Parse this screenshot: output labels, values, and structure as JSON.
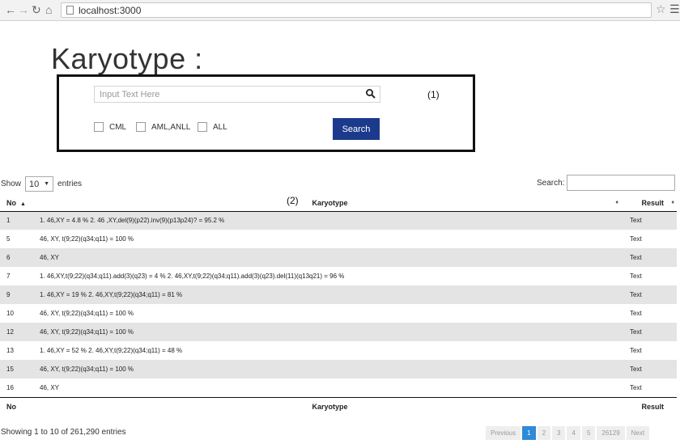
{
  "browser": {
    "url": "localhost:3000"
  },
  "page": {
    "title": "Karyotype :"
  },
  "search_panel": {
    "placeholder": "Input Text Here",
    "annotation": "(1)",
    "checkboxes": [
      {
        "label": "CML",
        "checked": false
      },
      {
        "label": "AML,ANLL",
        "checked": false
      },
      {
        "label": "ALL",
        "checked": false
      }
    ],
    "search_button": "Search"
  },
  "table_controls": {
    "show_label": "Show",
    "page_length": "10",
    "entries_label": "entries",
    "search_label": "Search:"
  },
  "table": {
    "annotation": "(2)",
    "columns": [
      "No",
      "Karyotype",
      "Result"
    ],
    "rows": [
      {
        "no": "1",
        "karyotype": "1. 46,XY = 4.8 % 2. 46 ,XY,del(9)(p22).inv(9)(p13p24)? = 95.2 %",
        "result": "Text"
      },
      {
        "no": "5",
        "karyotype": "46, XY, t(9;22)(q34;q11) = 100 %",
        "result": "Text"
      },
      {
        "no": "6",
        "karyotype": "46, XY",
        "result": "Text"
      },
      {
        "no": "7",
        "karyotype": "1. 46,XY,t(9;22)(q34;q11).add(3)(q23) = 4 % 2. 46,XY,t(9;22)(q34;q11).add(3)(q23).del(11)(q13q21) = 96 %",
        "result": "Text"
      },
      {
        "no": "9",
        "karyotype": "1. 46,XY = 19 % 2. 46,XY,t(9;22)(q34;q11) = 81 %",
        "result": "Text"
      },
      {
        "no": "10",
        "karyotype": "46, XY, t(9;22)(q34;q11) = 100 %",
        "result": "Text"
      },
      {
        "no": "12",
        "karyotype": "46, XY, t(9;22)(q34;q11) = 100 %",
        "result": "Text"
      },
      {
        "no": "13",
        "karyotype": "1. 46,XY = 52 % 2. 46,XY,t(9;22)(q34;q11) = 48 %",
        "result": "Text"
      },
      {
        "no": "15",
        "karyotype": "46, XY, t(9;22)(q34;q11) = 100 %",
        "result": "Text"
      },
      {
        "no": "16",
        "karyotype": "46, XY",
        "result": "Text"
      }
    ],
    "info": "Showing 1 to 10 of 261,290 entries"
  },
  "pagination": {
    "previous": "Previous",
    "pages": [
      "1",
      "2",
      "3",
      "4",
      "5",
      "26129"
    ],
    "active": "1",
    "next": "Next"
  },
  "colors": {
    "primary_button": "#1c3a8c",
    "active_page": "#2f8ad8",
    "row_stripe": "#e4e4e4"
  }
}
